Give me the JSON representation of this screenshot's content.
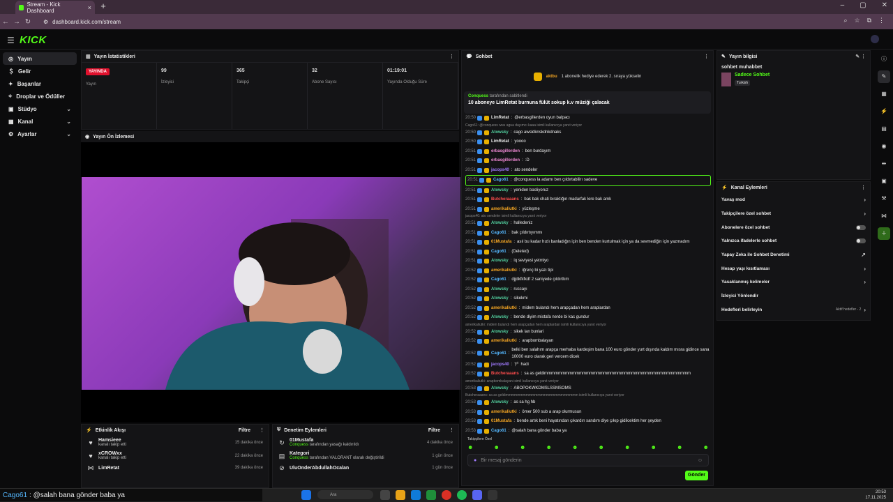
{
  "browser": {
    "tab_title": "Stream - Kick Dashboard",
    "url": "dashboard.kick.com/stream"
  },
  "brand": {
    "logo": "KICK",
    "accent": "#53fc18"
  },
  "nav": {
    "items": [
      {
        "label": "Yayın",
        "active": true
      },
      {
        "label": "Gelir"
      },
      {
        "label": "Başarılar"
      },
      {
        "label": "Droplar ve Ödüller"
      },
      {
        "label": "Stüdyo",
        "chevron": true
      },
      {
        "label": "Kanal",
        "chevron": true
      },
      {
        "label": "Ayarlar",
        "chevron": true
      }
    ]
  },
  "stats": {
    "title": "Yayın İstatistikleri",
    "cells": [
      {
        "value": "YAYINDA",
        "label": "Yayın"
      },
      {
        "value": "99",
        "label": "İzleyici"
      },
      {
        "value": "365",
        "label": "Takipçi"
      },
      {
        "value": "32",
        "label": "Abone Sayısı"
      },
      {
        "value": "01:19:01",
        "label": "Yayında Olduğu Süre"
      }
    ]
  },
  "preview": {
    "title": "Yayın Ön İzlemesi"
  },
  "activity": {
    "title": "Etkinlik Akışı",
    "filter": "Filtre",
    "items": [
      {
        "name": "Hamsieee",
        "desc": "kanalı takip etti",
        "time": "15 dakika önce"
      },
      {
        "name": "xCROWxx",
        "desc": "kanalı takip etti",
        "time": "22 dakika önce"
      },
      {
        "name": "LimRetat",
        "desc": "",
        "time": "39 dakika önce"
      }
    ]
  },
  "modact": {
    "title": "Denetim Eylemleri",
    "filter": "Filtre",
    "items": [
      {
        "name": "01Mustafa",
        "actor": "Conquess",
        "desc": "tarafından yasağı kaldırıldı",
        "time": "4 dakika önce"
      },
      {
        "name": "Kategori",
        "actor": "Conquess",
        "desc": "tarafından VALORANT olarak değiştirildi",
        "time": "1 gün önce"
      },
      {
        "name": "UluOnderAbdullahOcalan",
        "actor": "",
        "desc": "",
        "time": "1 gün önce"
      }
    ]
  },
  "chat": {
    "title": "Sohbet",
    "hype_user": "aktbu",
    "hype_text": "1 abonelik hediye ederek 2. sıraya yükselin",
    "pinned_user": "Conquess",
    "pinned_by": "tarafından sabitlendi",
    "pinned_msg": "10 aboneye LimRetat burnuna fülüt sokup k.v müziği çalacak",
    "messages": [
      {
        "t": "20:50",
        "u": "LimRetat",
        "c": "#e8e8e8",
        "m": "@erbasgillerden oyun balpacı"
      },
      {
        "reply": "Cago61: @conquess ıwaı agua dayımcı kaaa isimli kullanıcıya yanıt veriyor"
      },
      {
        "t": "20:50",
        "u": "Atowsky",
        "c": "#53d1a0",
        "m": "cago awsldknskdnkdnaks"
      },
      {
        "t": "20:50",
        "u": "LimRetat",
        "c": "#e8e8e8",
        "m": "yoooo"
      },
      {
        "t": "20:51",
        "u": "erbasgillerden",
        "c": "#f08ad5",
        "m": "ben burdayım"
      },
      {
        "t": "20:51",
        "u": "erbasgillerden",
        "c": "#f08ad5",
        "m": ":D"
      },
      {
        "t": "20:51",
        "u": "jacops40",
        "c": "#a17bff",
        "m": "ato sendeler"
      },
      {
        "t": "20:51",
        "u": "Cago61",
        "c": "#55b8ff",
        "m": "@conquess la adamı ben çıldırtabilirı sadeve",
        "hl": true
      },
      {
        "t": "20:51",
        "u": "Atowsky",
        "c": "#53d1a0",
        "m": "yeniden basliyoruz"
      },
      {
        "t": "20:51",
        "u": "Butcheraaans",
        "c": "#ff4d4d",
        "m": "bak bak chati bıraktığın madarfak lere bak amk"
      },
      {
        "t": "20:51",
        "u": "amerikaliutki",
        "c": "#f5a623",
        "m": "yüzleşme"
      },
      {
        "reply": "jacops40: ato sendeler isimli kullanıcıya yanıt veriyor"
      },
      {
        "t": "20:51",
        "u": "Atowsky",
        "c": "#53d1a0",
        "m": "halledeniz"
      },
      {
        "t": "20:51",
        "u": "Cago61",
        "c": "#55b8ff",
        "m": "bak çıldırtıyımmı"
      },
      {
        "t": "20:51",
        "u": "01Mustafa",
        "c": "#f5a623",
        "m": "asıl bu kadar hızlı banladığın için ben benden kurtulmak için ya da sevmediğin için yazmadım"
      },
      {
        "t": "20:51",
        "u": "Cago61",
        "c": "#55b8ff",
        "m": "(Deleted)"
      },
      {
        "t": "20:51",
        "u": "Atowsky",
        "c": "#53d1a0",
        "m": "iq seviyesi yetmiyo"
      },
      {
        "t": "20:52",
        "u": "amerikaliutki",
        "c": "#f5a623",
        "m": "iğrenç bi yazı tipi"
      },
      {
        "t": "20:52",
        "u": "Cago61",
        "c": "#55b8ff",
        "m": "djjdkfkfkdf 2 saniyede çıldırttım"
      },
      {
        "t": "20:52",
        "u": "Atowsky",
        "c": "#53d1a0",
        "m": "ruscayı"
      },
      {
        "t": "20:52",
        "u": "Atowsky",
        "c": "#53d1a0",
        "m": "sikekmi"
      },
      {
        "t": "20:52",
        "u": "amerikaliutki",
        "c": "#f5a623",
        "m": "midem bulandı hem arapçadan hem araplardan"
      },
      {
        "t": "20:52",
        "u": "Atowsky",
        "c": "#53d1a0",
        "m": "bende diyim mistafa nerde bi kac gundur"
      },
      {
        "reply": "amerikaliutki: midem bulandı hem arapçadan hem araplardan isimli kullanıcıya yanıt veriyor"
      },
      {
        "t": "20:52",
        "u": "Atowsky",
        "c": "#53d1a0",
        "m": "sikek lan bunlari"
      },
      {
        "t": "20:52",
        "u": "amerikaliutki",
        "c": "#f5a623",
        "m": "arapbombalayan"
      },
      {
        "t": "20:52",
        "u": "Cago61",
        "c": "#55b8ff",
        "m": "belki ben salahım arapça merhaba kardeşim bana 100 euro gönder yurt dışında kaldım mısra gidince sana 10000 euro olarak geri vercem dicek",
        "wrap": true
      },
      {
        "t": "20:52",
        "u": "jacops40",
        "c": "#a17bff",
        "m": "🏴 hadi"
      },
      {
        "t": "20:52",
        "u": "Butcheraaans",
        "c": "#ff4d4d",
        "m": "sa as geldimmmmmmmmmmmmmmmmmmmmmmmmmmmmmmmmmmmmmmmmmm"
      },
      {
        "reply": "amerikaliutki: arapbombalayan isimli kullanıcıya yanıt veriyor"
      },
      {
        "t": "20:53",
        "u": "Atowsky",
        "c": "#53d1a0",
        "m": "ABOPOKWKDMSLSSMSOMS"
      },
      {
        "reply": "Butcheraaans: sa as geldimmmmmmmmmmmmmmmmmmmmmmmmm isimli kullanıcıya yanıt veriyor"
      },
      {
        "t": "20:53",
        "u": "Atowsky",
        "c": "#53d1a0",
        "m": "as sa hg hb"
      },
      {
        "t": "20:53",
        "u": "amerikaliutki",
        "c": "#f5a623",
        "m": "ömer 500 sub a arap olurmusun"
      },
      {
        "t": "20:53",
        "u": "01Mustafa",
        "c": "#f5a623",
        "m": "bende artık beni hayatından çıkardın sandım diye çıkıp gidilcektim her şeyden"
      },
      {
        "t": "20:53",
        "u": "Cago61",
        "c": "#55b8ff",
        "m": "@salah bana gönder baba ya"
      }
    ],
    "subtag": "Takipçilere Özel",
    "input_placeholder": "Bir mesaj gönderin",
    "send": "Gönder"
  },
  "info": {
    "title": "Yayın bilgisi",
    "stream_title": "sohbet muhabbet",
    "category": "Sadece Sohbet",
    "tag": "Turkish"
  },
  "actions": {
    "title": "Kanal Eylemleri",
    "items": [
      {
        "label": "Yavaş mod",
        "kind": "chev"
      },
      {
        "label": "Takipçilere özel sohbet",
        "kind": "chev"
      },
      {
        "label": "Abonelere özel sohbet",
        "kind": "toggle"
      },
      {
        "label": "Yalnızca ifadelerle sohbet",
        "kind": "toggle"
      },
      {
        "label": "Yapay Zeka ile Sohbet Denetimi",
        "kind": "ext"
      },
      {
        "label": "Hesap yaşı kısıtlaması",
        "kind": "chev"
      },
      {
        "label": "Yasaklanmış kelimeler",
        "kind": "chev"
      },
      {
        "label": "İzleyici Yönlendir",
        "kind": "none"
      },
      {
        "label": "Hedefleri belirleyin",
        "kind": "chev",
        "extra": "Aktif hedefler - 2"
      }
    ]
  },
  "overlay": {
    "user": "Cago61",
    "text": ": @salah bana gönder baba ya"
  },
  "taskbar": {
    "search": "Ara",
    "time": "20:53",
    "date": "17.11.2025"
  }
}
